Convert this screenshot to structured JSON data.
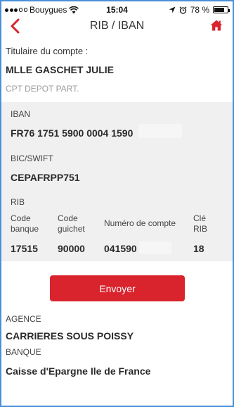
{
  "status_bar": {
    "carrier": "Bouygues",
    "time": "15:04",
    "battery_text": "78 %",
    "battery_level": 0.78
  },
  "nav": {
    "title": "RIB / IBAN",
    "back_icon": "chevron-left-icon",
    "home_icon": "home-icon"
  },
  "account": {
    "owner_label": "Titulaire du compte :",
    "owner_name": "MLLE GASCHET JULIE",
    "account_type": "CPT DEPOT PART."
  },
  "iban": {
    "label": "IBAN",
    "value": "FR76 1751 5900 0004 1590"
  },
  "bic": {
    "label": "BIC/SWIFT",
    "value": "CEPAFRPP751"
  },
  "rib": {
    "label": "RIB",
    "columns": [
      {
        "label_line1": "Code",
        "label_line2": "banque",
        "value": "17515"
      },
      {
        "label_line1": "Code",
        "label_line2": "guichet",
        "value": "90000"
      },
      {
        "label_line1": "Numéro de compte",
        "label_line2": "",
        "value": "041590"
      },
      {
        "label_line1": "Clé",
        "label_line2": "RIB",
        "value": "18"
      }
    ]
  },
  "actions": {
    "send_label": "Envoyer"
  },
  "agency": {
    "label": "AGENCE",
    "value": "CARRIERES SOUS POISSY"
  },
  "bank": {
    "label": "BANQUE",
    "value": "Caisse d'Epargne Ile de France"
  },
  "colors": {
    "accent": "#d9232d",
    "card_background": "#f0f0f0",
    "frame_border": "#4a90d9"
  }
}
